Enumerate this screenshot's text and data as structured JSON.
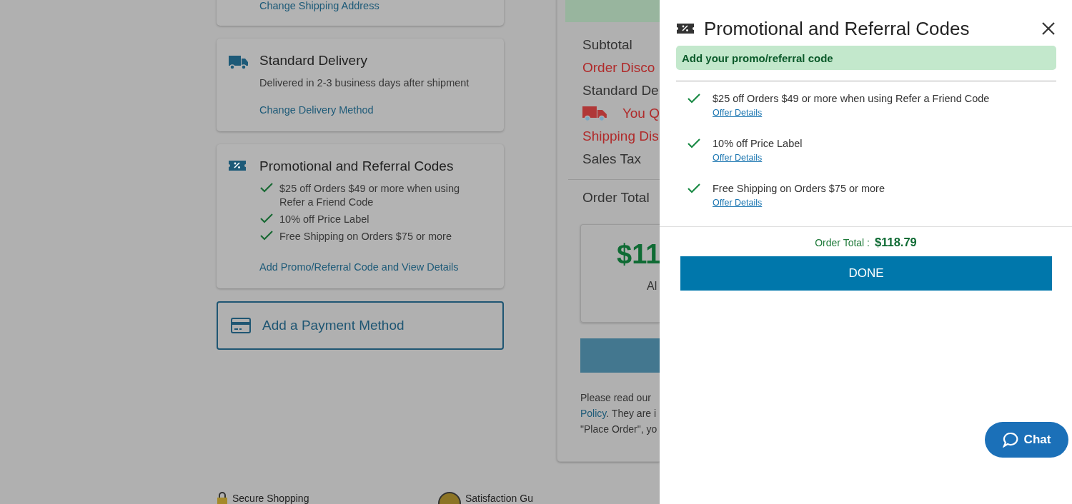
{
  "page": {
    "shipping_card": {
      "link": "Change Shipping Address"
    },
    "delivery_card": {
      "title": "Standard Delivery",
      "text": "Delivered in 2-3 business days after shipment",
      "link": "Change Delivery Method"
    },
    "promo_card": {
      "title": "Promotional and Referral Codes",
      "offers": [
        {
          "text": "$25 off Orders $49 or more when using Refer a Friend Code",
          "applied": true
        },
        {
          "text": "10% off Price Label",
          "applied": true
        },
        {
          "text": "Free Shipping on Orders $75 or more",
          "applied": true
        }
      ],
      "link": "Add Promo/Referral Code and View Details"
    },
    "payment_button": "Add a Payment Method",
    "summary": {
      "lines": [
        {
          "text": "Subtotal",
          "kind": "plain"
        },
        {
          "text": "Order Disco",
          "kind": "discount"
        },
        {
          "text": "Standard De",
          "kind": "plain"
        },
        {
          "text": "You Q",
          "kind": "truck"
        },
        {
          "text": "Shipping Dis",
          "kind": "discount"
        },
        {
          "text": "Sales Tax",
          "kind": "plain"
        }
      ],
      "total_label": "Order Total",
      "total_amount": "$11",
      "total_note": "Al",
      "notice": [
        {
          "text": "Please read our "
        },
        {
          "text": "Policy",
          "link": true
        },
        {
          "text": ". They are i"
        },
        {
          "text": "\"Place Order\", yo"
        }
      ]
    },
    "footer": [
      {
        "text": "Secure Shopping",
        "kind": "lock"
      },
      {
        "text": "Satisfaction Gu",
        "kind": "seal"
      }
    ]
  },
  "drawer": {
    "title": "Promotional and Referral Codes",
    "banner": "Add your promo/referral code",
    "offers": [
      {
        "text": "$25 off Orders $49 or more when using Refer a Friend Code",
        "applied": true,
        "link": "Offer Details"
      },
      {
        "text": "10% off Price Label",
        "applied": true,
        "link": "Offer Details"
      },
      {
        "text": "Free Shipping on Orders $75 or more",
        "applied": true,
        "link": "Offer Details"
      }
    ],
    "total_label": "Order Total :",
    "total_amount": "$118.79",
    "done": "DONE"
  },
  "chat": {
    "label": "Chat"
  }
}
